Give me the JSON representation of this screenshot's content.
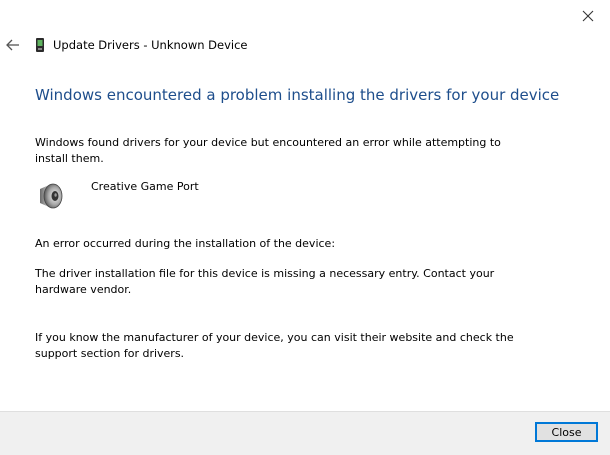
{
  "window": {
    "title": "Update Drivers - Unknown Device",
    "close_icon": "close-icon",
    "back_icon": "back-arrow-icon",
    "device_icon": "device-manager-icon"
  },
  "main": {
    "heading": "Windows encountered a problem installing the drivers for your device",
    "found_text": "Windows found drivers for your device but encountered an error while attempting to install them.",
    "device_name": "Creative Game Port",
    "device_icon": "speaker-icon",
    "error_intro": "An error occurred during the installation of the device:",
    "error_detail": "The driver installation file for this device is missing a necessary entry. Contact your hardware vendor.",
    "help_text": "If you know the manufacturer of your device, you can visit their website and check the support section for drivers."
  },
  "footer": {
    "close_label": "Close"
  },
  "colors": {
    "heading": "#1e4e8c",
    "footer_bg": "#f0f0f0",
    "button_border": "#0078d7"
  }
}
